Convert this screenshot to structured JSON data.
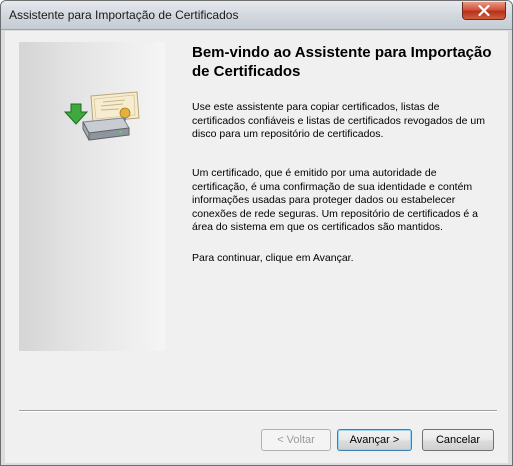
{
  "window": {
    "title": "Assistente para Importação de Certificados",
    "close_label": "Fechar"
  },
  "main": {
    "heading": "Bem-vindo ao Assistente para Importação de Certificados",
    "paragraphs": [
      "Use este assistente para copiar certificados, listas de certificados confiáveis e listas de certificados revogados de um disco para um repositório de certificados.",
      "Um certificado, que é emitido por uma autoridade de certificação, é uma confirmação de sua identidade e contém informações usadas para proteger dados ou estabelecer conexões de rede seguras. Um repositório de certificados é a área do sistema em que os certificados são mantidos.",
      "Para continuar, clique em Avançar."
    ]
  },
  "buttons": {
    "back": "< Voltar",
    "next": "Avançar >",
    "cancel": "Cancelar"
  },
  "icons": {
    "close": "close-icon",
    "illustration": "certificate-import-icon"
  },
  "colors": {
    "close_button": "#c8442a",
    "dialog_background": "#f0f0f0",
    "default_button_border": "#3c7fb1"
  }
}
